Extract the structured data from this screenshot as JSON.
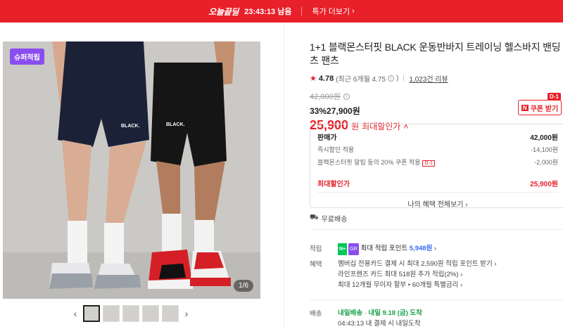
{
  "banner": {
    "brand": "오늘끝딜",
    "timer": "23:43:13 남음",
    "more": "특가 더보기",
    "color": "#e8202a"
  },
  "gallery": {
    "badge": "슈퍼적립",
    "counter": "1/6",
    "thumb_count": 5
  },
  "product": {
    "title": "1+1 블랙몬스터핏 BLACK 운동반바지 트레이닝 헬스바지 밴딩 쇼츠 팬츠",
    "rating": "4.78",
    "rating_detail": "(최근 6개월 4.75",
    "review_count": "1,023건 리뷰",
    "original_price": "42,000원",
    "discount_rate": "33%",
    "discount_price": "27,900원",
    "final_price": "25,900",
    "final_unit": "원",
    "final_label": "최대할인가",
    "coupon_label": "쿠폰 받기",
    "coupon_dday": "D-1"
  },
  "pricebox": {
    "sale_label": "판매가",
    "sale_value": "42,000원",
    "instant_label": "즉시할인 적용",
    "instant_value": "-14,100원",
    "coupon_label": "블랙몬스터핏 알림 동의 20% 쿠폰 적용",
    "coupon_tag": "D-1",
    "coupon_value": "-2,000원",
    "max_label": "최대할인가",
    "max_value": "25,900원",
    "benefit_link": "나의 혜택 전체보기"
  },
  "shipping_free": "무료배송",
  "points": {
    "label": "적립",
    "npay": "N+",
    "grade": "GR",
    "text": "최대 적립 포인트",
    "value": "5,948원"
  },
  "benefits": {
    "label": "혜택",
    "lines": [
      "멤버십 전용카드 결제 시 최대 2,590원 적립 포인트 받기",
      "라인프렌즈 카드 최대 518원 추가 적립(2%)",
      "최대 12개월 무이자 할부 • 60개월 특별금리"
    ]
  },
  "delivery": {
    "label": "배송",
    "tag": "내일배송",
    "arrive": "내일 9.18 (금) 도착",
    "deadline": "04:43:13  내 결제 시 내일도착"
  }
}
